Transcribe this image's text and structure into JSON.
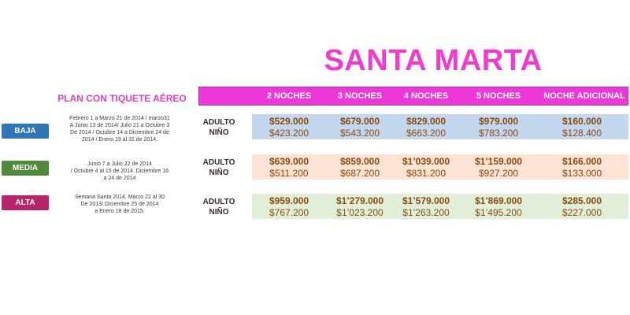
{
  "title": "SANTA MARTA",
  "plan_label": "PLAN CON TIQUETE AÉREO",
  "columns": [
    "2 NOCHES",
    "3 NOCHES",
    "4 NOCHES",
    "5 NOCHES",
    "NOCHE ADICIONAL"
  ],
  "labels": {
    "adult": "ADULTO",
    "child": "NIÑO"
  },
  "colors": {
    "title": "#f23ad0",
    "header_bar": "#ee37d8",
    "baja": "#2e76b8",
    "media": "#4e8a3a",
    "alta": "#b8246a",
    "band_baja": "#c3d8ee",
    "band_media": "#fce3d3",
    "band_alta": "#e2efd8"
  },
  "seasons": [
    {
      "name": "BAJA",
      "dates": "Febrero 1 a Marzo 21 de 2014 / marzo31\nA Junio 13 de 2014/ Julio 21 a Octubre 3\nDe 2014 / Octubre 14 a Diciembre 24 de\n2014 / Enero 19 al 31 de 2014.",
      "adult": [
        "$529.000",
        "$679.000",
        "$829.000",
        "$979.000",
        "$160.000"
      ],
      "child": [
        "$423.200",
        "$543.200",
        "$663.200",
        "$783.200",
        "$128.400"
      ]
    },
    {
      "name": "MEDIA",
      "dates": "Junio 7 a Julio 22 de  2014\n/ Octubre 4 al 15 de 2014.  Diciembre 16\na 24 de 2014",
      "adult": [
        "$639.000",
        "$859.000",
        "$1’039.000",
        "$1’159.000",
        "$166.000"
      ],
      "child": [
        "$511.200",
        "$687.200",
        "$831.200",
        "$927.200",
        "$133.000"
      ]
    },
    {
      "name": "ALTA",
      "dates": "Semana Santa 2014, Marzo 22 al 30\nDe 2013/ Diciembre 25 de 2014\na Enero 18 de 2015.",
      "adult": [
        "$959.000",
        "$1’279.000",
        "$1’579.000",
        "$1’869.000",
        "$285.000"
      ],
      "child": [
        "$767.200",
        "$1’023.200",
        "$1’263.200",
        "$1’495.200",
        "$227.000"
      ]
    }
  ]
}
